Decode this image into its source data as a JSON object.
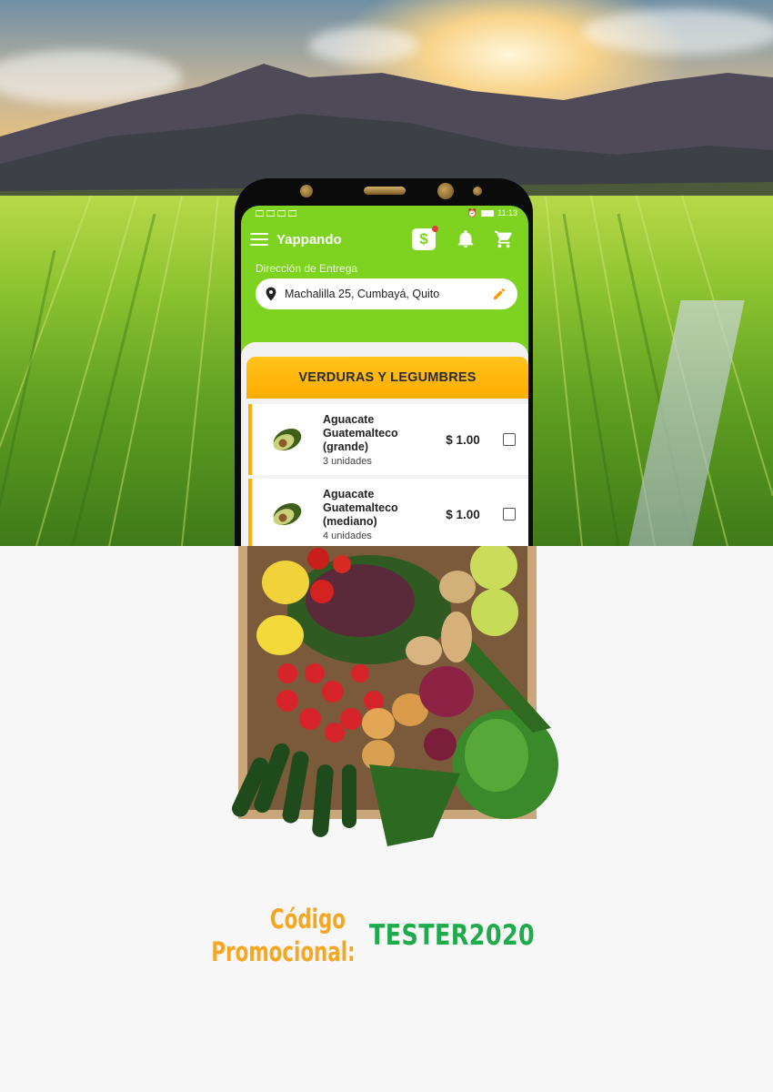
{
  "app": {
    "title": "Yappando",
    "status_time": "11:13",
    "address_label": "Dirección de Entrega",
    "address_value": "Machalilla 25, Cumbayá, Quito",
    "category": "VERDURAS Y LEGUMBRES"
  },
  "products": [
    {
      "name_lines": [
        "Aguacate",
        "Guatemalteco",
        "(grande)"
      ],
      "units": "3 unidades",
      "price": "$ 1.00"
    },
    {
      "name_lines": [
        "Aguacate",
        "Guatemalteco",
        "(mediano)"
      ],
      "units": "4 unidades",
      "price": "$ 1.00"
    }
  ],
  "promo": {
    "label_line1": "Código",
    "label_line2": "Promocional:",
    "code": "TESTER2020"
  },
  "icons": {
    "menu": "hamburger-icon",
    "wallet": "dollar-icon",
    "notifications": "bell-icon",
    "cart": "cart-icon",
    "location": "pin-icon",
    "edit": "pencil-icon"
  },
  "colors": {
    "app_green": "#7ed321",
    "accent_orange": "#ffad00",
    "promo_label": "#f5a623",
    "promo_code": "#1faa4b"
  }
}
